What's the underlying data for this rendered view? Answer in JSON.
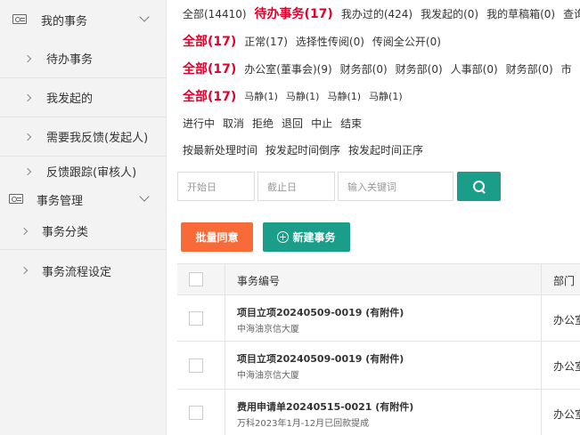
{
  "sidebar": {
    "groups": [
      {
        "label": "我的事务",
        "items": [
          "待办事务",
          "我发起的",
          "需要我反馈(发起人)",
          "反馈跟踪(审核人)"
        ]
      },
      {
        "label": "事务管理",
        "items": [
          "事务分类",
          "事务流程设定"
        ]
      }
    ]
  },
  "filters": {
    "row1": [
      "全部(14410)",
      "待办事务(17)",
      "我办过的(424)",
      "我发起的(0)",
      "我的草稿箱(0)",
      "查询"
    ],
    "row2": [
      "全部(17)",
      "正常(17)",
      "选择性传阅(0)",
      "传阅全公开(0)"
    ],
    "row3": [
      "全部(17)",
      "办公室(董事会)(9)",
      "财务部(0)",
      "财务部(0)",
      "人事部(0)",
      "财务部(0)",
      "市"
    ],
    "row4": [
      "全部(17)",
      "马静(1)",
      "马静(1)",
      "马静(1)",
      "马静(1)"
    ],
    "row5": [
      "进行中",
      "取消",
      "拒绝",
      "退回",
      "中止",
      "结束"
    ],
    "row6": [
      "按最新处理时间",
      "按发起时间倒序",
      "按发起时间正序"
    ]
  },
  "search": {
    "start_placeholder": "开始日",
    "end_placeholder": "截止日",
    "keyword_placeholder": "输入关键词"
  },
  "actions": {
    "batch_label": "批量同意",
    "new_label": "新建事务"
  },
  "table": {
    "headers": [
      "事务编号",
      "部门"
    ],
    "rows": [
      {
        "title": "项目立项20240509-0019 (有附件)",
        "sub": "中海油京信大厦",
        "dept": "办公室"
      },
      {
        "title": "项目立项20240509-0019 (有附件)",
        "sub": "中海油京信大厦",
        "dept": "办公室"
      },
      {
        "title": "费用申请单20240515-0021 (有附件)",
        "sub": "万科2023年1月-12月已回款提成",
        "dept": "办公室"
      }
    ]
  },
  "colors": {
    "accent_red": "#e4002b",
    "teal": "#1a9e8a",
    "orange": "#f86b38"
  }
}
